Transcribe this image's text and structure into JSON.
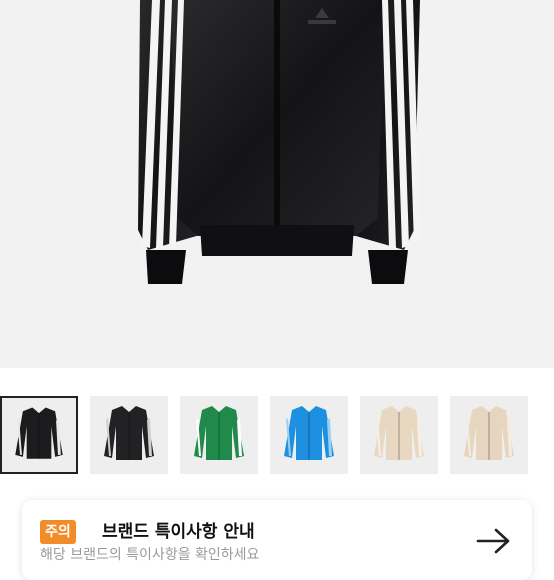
{
  "product": {
    "image_icon": "track-jacket-black-icon",
    "thumbnails": [
      {
        "name": "black-leather",
        "color": "#1c1c1e",
        "stripe": "#e8e8e8",
        "selected": true
      },
      {
        "name": "black-leather-alt",
        "color": "#222224",
        "stripe": "#cfcfcf",
        "selected": false
      },
      {
        "name": "green",
        "color": "#1f8a4a",
        "stripe": "#ffffff",
        "selected": false
      },
      {
        "name": "blue",
        "color": "#1e90e0",
        "stripe": "#9ad0f5",
        "selected": false
      },
      {
        "name": "beige",
        "color": "#e8d8c2",
        "stripe": "#f6efe4",
        "selected": false
      },
      {
        "name": "beige-alt",
        "color": "#e6d6c0",
        "stripe": "#f4ece0",
        "selected": false
      }
    ]
  },
  "notice": {
    "badge": "주의",
    "badge_color": "#f28c28",
    "title": "브랜드 특이사항 안내",
    "subtitle": "해당 브랜드의 특이사항을 확인하세요",
    "arrow_icon": "arrow-right-icon"
  }
}
